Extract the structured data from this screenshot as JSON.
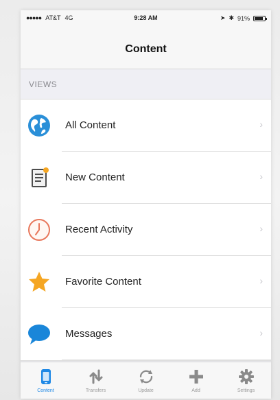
{
  "status_bar": {
    "signal": "●●●●●",
    "carrier": "AT&T",
    "network": "4G",
    "time": "9:28 AM",
    "battery_text": "91%"
  },
  "nav": {
    "title": "Content"
  },
  "section": {
    "header": "VIEWS"
  },
  "rows": [
    {
      "label": "All Content",
      "icon": "globe-icon"
    },
    {
      "label": "New Content",
      "icon": "new-document-icon"
    },
    {
      "label": "Recent Activity",
      "icon": "clock-icon"
    },
    {
      "label": "Favorite Content",
      "icon": "star-icon"
    },
    {
      "label": "Messages",
      "icon": "speech-bubble-icon"
    }
  ],
  "chevron": "›",
  "tabs": [
    {
      "label": "Content",
      "icon": "phone-icon",
      "active": true
    },
    {
      "label": "Transfers",
      "icon": "transfer-arrows-icon",
      "active": false
    },
    {
      "label": "Update",
      "icon": "refresh-icon",
      "active": false
    },
    {
      "label": "Add",
      "icon": "plus-icon",
      "active": false
    },
    {
      "label": "Settings",
      "icon": "gear-icon",
      "active": false
    }
  ],
  "colors": {
    "accent": "#1e88e5",
    "globe": "#2a8fd8",
    "clock": "#e8775b",
    "star": "#f5a623",
    "bubble": "#1a86d9",
    "tab_inactive": "#8a8a8a"
  }
}
